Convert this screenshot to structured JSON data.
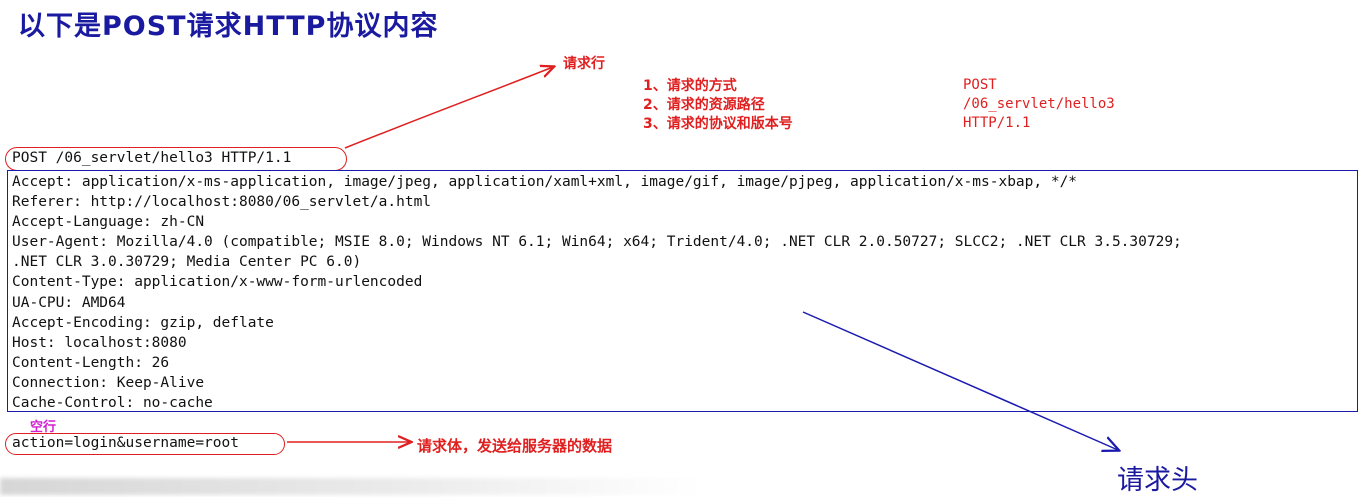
{
  "title": "以下是POST请求HTTP协议内容",
  "request_line_label": "请求行",
  "request_line_items": [
    {
      "label": "1、请求的方式",
      "value": "POST"
    },
    {
      "label": "2、请求的资源路径",
      "value": "/06_servlet/hello3"
    },
    {
      "label": "3、请求的协议和版本号",
      "value": "HTTP/1.1"
    }
  ],
  "request_line": "POST /06_servlet/hello3 HTTP/1.1",
  "headers": [
    "Accept: application/x-ms-application, image/jpeg, application/xaml+xml, image/gif, image/pjpeg, application/x-ms-xbap, */*",
    "Referer: http://localhost:8080/06_servlet/a.html",
    "Accept-Language: zh-CN",
    "User-Agent: Mozilla/4.0 (compatible; MSIE 8.0; Windows NT 6.1; Win64; x64; Trident/4.0; .NET CLR 2.0.50727; SLCC2; .NET CLR 3.5.30729;",
    ".NET CLR 3.0.30729; Media Center PC 6.0)",
    "Content-Type: application/x-www-form-urlencoded",
    "UA-CPU: AMD64",
    "Accept-Encoding: gzip, deflate",
    "Host: localhost:8080",
    "Content-Length: 26",
    "Connection: Keep-Alive",
    "Cache-Control: no-cache"
  ],
  "blank_line_label": "空行",
  "request_body": "action=login&username=root",
  "request_body_label": "请求体，发送给服务器的数据",
  "request_headers_label": "请求头",
  "colors": {
    "title": "#1a1aa0",
    "annotation_red": "#e02020",
    "header_box": "#1a1ab0",
    "blank_line": "#d020d0"
  }
}
